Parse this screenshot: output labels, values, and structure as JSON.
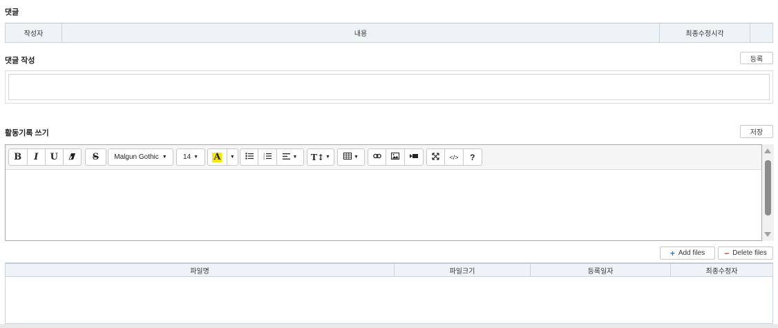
{
  "comments": {
    "title": "댓글",
    "columns": [
      "작성자",
      "내용",
      "최종수정시각",
      ""
    ]
  },
  "comment_write": {
    "title": "댓글 작성",
    "register_label": "등록",
    "text": ""
  },
  "activity": {
    "title": "활동기록 쓰기",
    "save_label": "저장"
  },
  "toolbar": {
    "bold": "B",
    "italic": "I",
    "underline": "U",
    "eraser": "eraser",
    "strike": "S",
    "font_name": "Malgun Gothic",
    "font_size": "14",
    "color_letter": "A",
    "highlight_color": "#f5e900",
    "text_size_icon": "T↕",
    "help": "?",
    "code": "</>"
  },
  "files": {
    "add_label": "Add files",
    "delete_label": "Delete files",
    "columns": [
      "파일명",
      "파일크기",
      "등록일자",
      "최종수정자"
    ]
  },
  "colors": {
    "header_bg": "#eef3f8",
    "border": "#c9d3dc",
    "add_icon": "#2b7cd3",
    "delete_icon": "#c0392b"
  }
}
